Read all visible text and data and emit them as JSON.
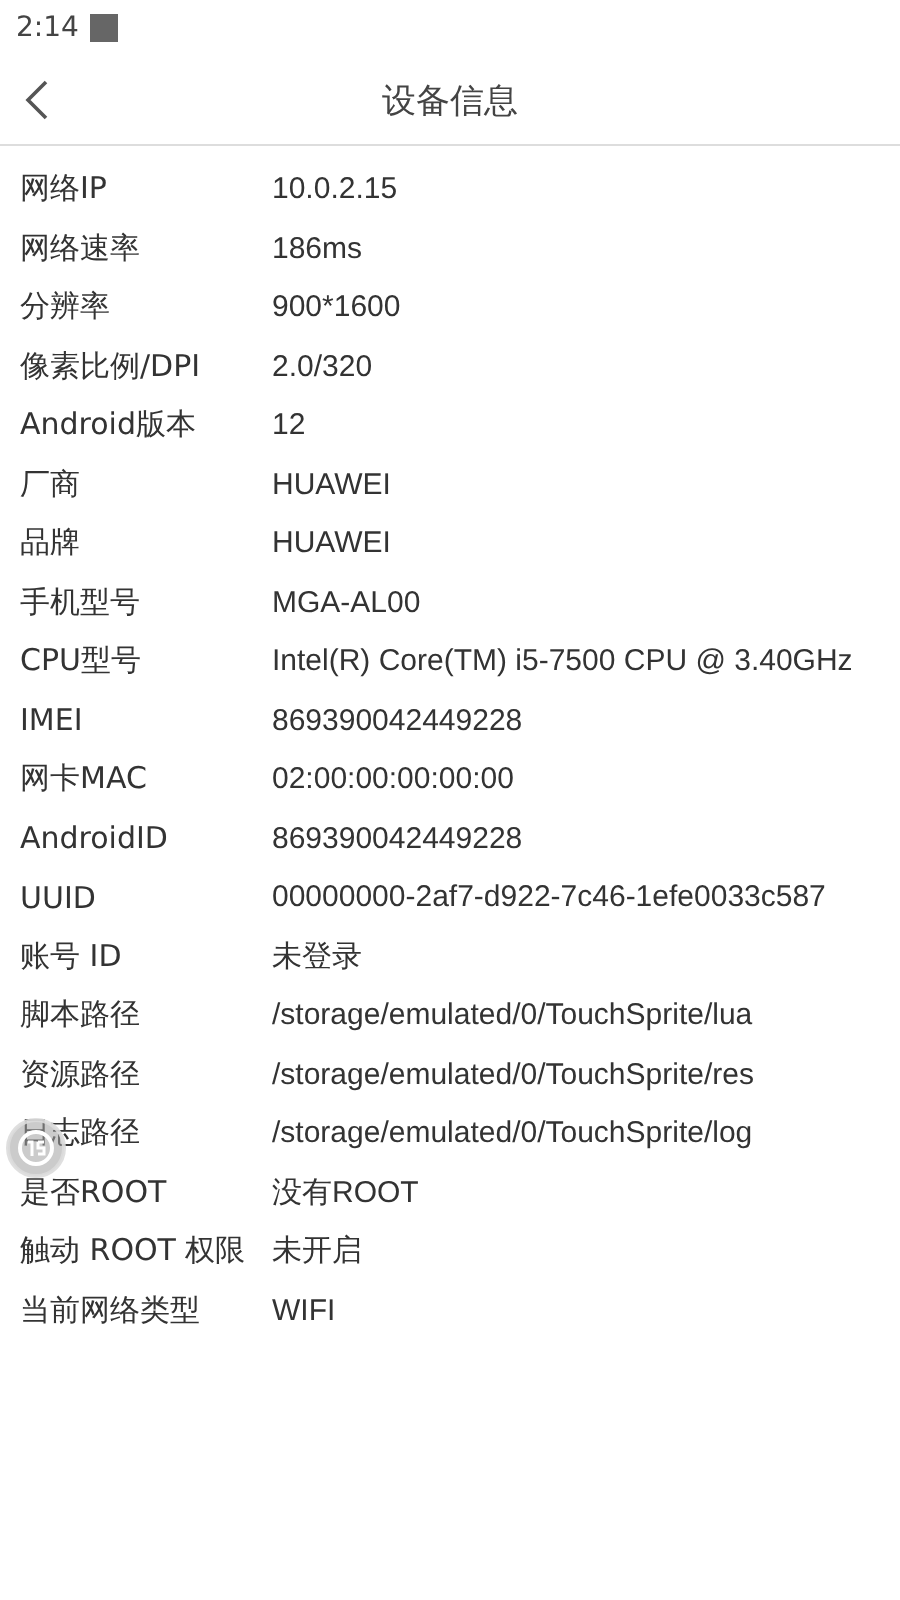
{
  "status_bar": {
    "time": "2:14"
  },
  "header": {
    "title": "设备信息"
  },
  "rows": [
    {
      "label": "网络IP",
      "value": "10.0.2.15"
    },
    {
      "label": "网络速率",
      "value": "186ms"
    },
    {
      "label": "分辨率",
      "value": "900*1600"
    },
    {
      "label": "像素比例/DPI",
      "value": "2.0/320"
    },
    {
      "label": "Android版本",
      "value": "12"
    },
    {
      "label": "厂商",
      "value": "HUAWEI"
    },
    {
      "label": "品牌",
      "value": "HUAWEI"
    },
    {
      "label": "手机型号",
      "value": "MGA-AL00"
    },
    {
      "label": "CPU型号",
      "value": "Intel(R) Core(TM) i5-7500 CPU @ 3.40GHz"
    },
    {
      "label": "IMEI",
      "value": "869390042449228"
    },
    {
      "label": "网卡MAC",
      "value": "02:00:00:00:00:00"
    },
    {
      "label": "AndroidID",
      "value": "869390042449228"
    },
    {
      "label": "UUID",
      "value": "00000000-2af7-d922-7c46-1efe0033c587"
    },
    {
      "label": "账号 ID",
      "value": "未登录"
    },
    {
      "label": "脚本路径",
      "value": "/storage/emulated/0/TouchSprite/lua"
    },
    {
      "label": "资源路径",
      "value": "/storage/emulated/0/TouchSprite/res"
    },
    {
      "label": "日志路径",
      "value": "/storage/emulated/0/TouchSprite/log"
    },
    {
      "label": "是否ROOT",
      "value": "没有ROOT"
    },
    {
      "label": "触动 ROOT 权限",
      "value": "未开启"
    },
    {
      "label": "当前网络类型",
      "value": "WIFI"
    }
  ]
}
